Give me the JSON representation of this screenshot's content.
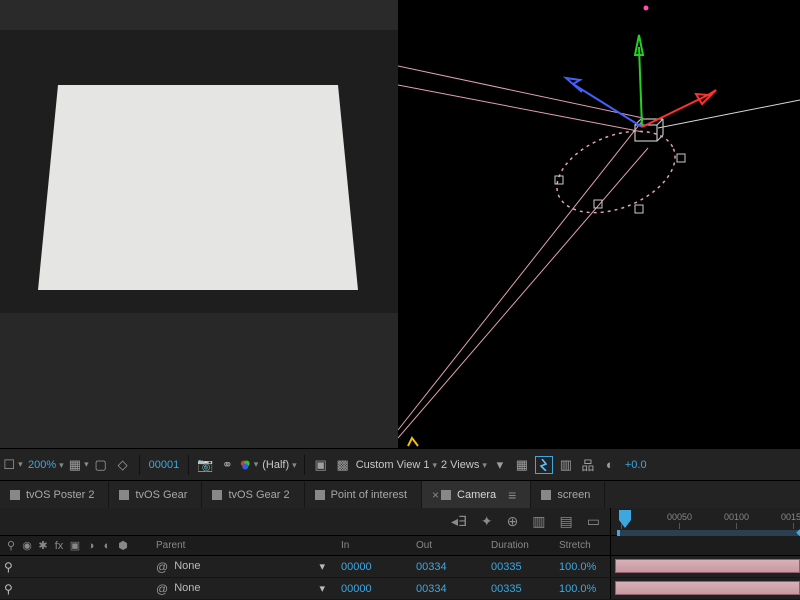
{
  "toolbar": {
    "zoom": "200%",
    "frame": "00001",
    "resolution": "(Half)",
    "view_mode": "Custom View 1",
    "view_count": "2 Views",
    "exposure": "+0.0"
  },
  "tabs": [
    {
      "label": "tvOS Poster 2",
      "active": false
    },
    {
      "label": "tvOS Gear",
      "active": false
    },
    {
      "label": "tvOS Gear 2",
      "active": false
    },
    {
      "label": "Point of interest",
      "active": false
    },
    {
      "label": "Camera",
      "active": true
    },
    {
      "label": "screen",
      "active": false
    }
  ],
  "ruler": [
    "00050",
    "00100",
    "0015"
  ],
  "columns": {
    "parent": "Parent",
    "in": "In",
    "out": "Out",
    "duration": "Duration",
    "stretch": "Stretch"
  },
  "rows": [
    {
      "parent": "None",
      "in": "00000",
      "out": "00334",
      "duration": "00335",
      "stretch": "100.0%"
    },
    {
      "parent": "None",
      "in": "00000",
      "out": "00334",
      "duration": "00335",
      "stretch": "100.0%"
    }
  ]
}
